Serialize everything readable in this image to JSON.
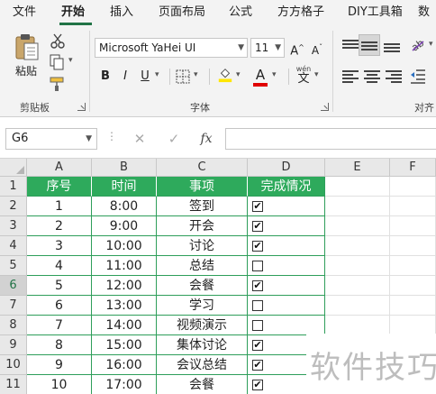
{
  "ribbon": {
    "tabs": [
      "文件",
      "开始",
      "插入",
      "页面布局",
      "公式",
      "方方格子",
      "DIY工具箱",
      "数"
    ],
    "active_tab": "开始",
    "clipboard": {
      "paste_label": "粘贴",
      "group_label": "剪贴板"
    },
    "font": {
      "font_name": "Microsoft YaHei UI",
      "font_size": "11",
      "increase_label": "A",
      "decrease_label": "A",
      "bold_label": "B",
      "italic_label": "I",
      "underline_label": "U",
      "phonetic_label": "wén",
      "group_label": "字体"
    },
    "alignment": {
      "group_label": "对齐"
    }
  },
  "formula_bar": {
    "cell_ref": "G6",
    "fx_label": "fx",
    "dots": "⋮",
    "cancel_glyph": "✕",
    "enter_glyph": "✓",
    "formula": ""
  },
  "sheet": {
    "columns": [
      "A",
      "B",
      "C",
      "D",
      "E",
      "F"
    ],
    "rows": [
      "1",
      "2",
      "3",
      "4",
      "5",
      "6",
      "7",
      "8",
      "9",
      "10",
      "11"
    ],
    "headers": [
      "序号",
      "时间",
      "事项",
      "完成情况"
    ],
    "records": [
      {
        "no": "1",
        "time": "8:00",
        "item": "签到",
        "done": true
      },
      {
        "no": "2",
        "time": "9:00",
        "item": "开会",
        "done": true
      },
      {
        "no": "3",
        "time": "10:00",
        "item": "讨论",
        "done": true
      },
      {
        "no": "4",
        "time": "11:00",
        "item": "总结",
        "done": false
      },
      {
        "no": "5",
        "time": "12:00",
        "item": "会餐",
        "done": true
      },
      {
        "no": "6",
        "time": "13:00",
        "item": "学习",
        "done": false
      },
      {
        "no": "7",
        "time": "14:00",
        "item": "视频演示",
        "done": false
      },
      {
        "no": "8",
        "time": "15:00",
        "item": "集体讨论",
        "done": true
      },
      {
        "no": "9",
        "time": "16:00",
        "item": "会议总结",
        "done": true
      },
      {
        "no": "10",
        "time": "17:00",
        "item": "会餐",
        "done": true
      }
    ],
    "check_mark": "✔"
  },
  "watermark": "软件技巧",
  "colors": {
    "accent": "#217346",
    "header_fill": "#2eaa5c",
    "table_border": "#2e9e5a"
  }
}
